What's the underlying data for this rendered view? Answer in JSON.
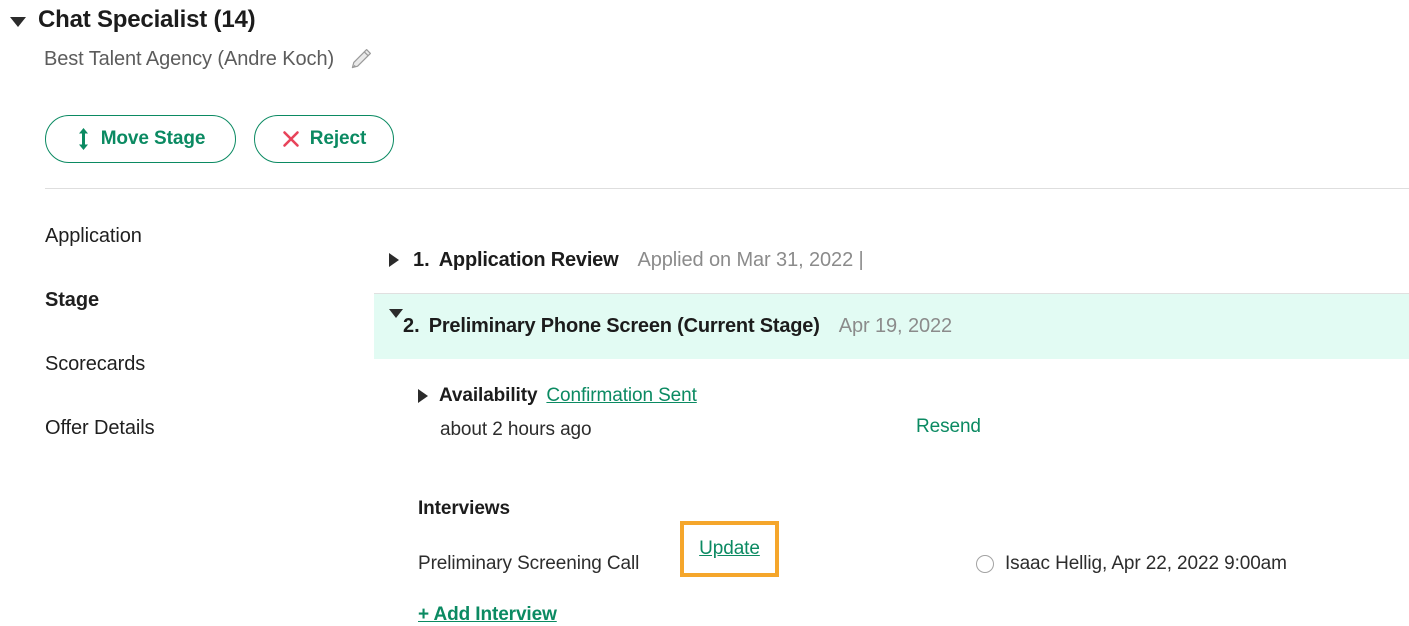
{
  "header": {
    "title": "Chat Specialist (14)",
    "subtitle": "Best Talent Agency (Andre Koch)",
    "edit_icon": "pencil-icon",
    "expand_icon": "caret-down-icon"
  },
  "actions": {
    "move_stage": {
      "label": "Move Stage",
      "icon": "up-down-arrow-icon"
    },
    "reject": {
      "label": "Reject",
      "icon": "close-x-icon"
    }
  },
  "left_nav": {
    "items": [
      {
        "label": "Application",
        "active": false
      },
      {
        "label": "Stage",
        "active": true
      },
      {
        "label": "Scorecards",
        "active": false
      },
      {
        "label": "Offer Details",
        "active": false
      }
    ]
  },
  "stages": [
    {
      "number": "1.",
      "name": "Application Review",
      "date": "Applied on Mar 31, 2022 |",
      "expanded": false
    },
    {
      "number": "2.",
      "name": "Preliminary Phone Screen (Current Stage)",
      "date": "Apr 19, 2022",
      "expanded": true
    }
  ],
  "availability": {
    "label": "Availability",
    "status": "Confirmation Sent",
    "time_ago": "about 2 hours ago",
    "resend_label": "Resend"
  },
  "interviews": {
    "title": "Interviews",
    "rows": [
      {
        "name": "Preliminary Screening Call",
        "update_label": "Update",
        "interviewer": "Isaac Hellig, Apr 22, 2022 9:00am"
      }
    ],
    "add_label": "+ Add Interview"
  },
  "colors": {
    "accent_green": "#0b8a62",
    "highlight_orange": "#f5a62b",
    "current_stage_bg": "#e2fbf3",
    "reject_red": "#e8435a",
    "muted_text": "#8b8b8b"
  }
}
